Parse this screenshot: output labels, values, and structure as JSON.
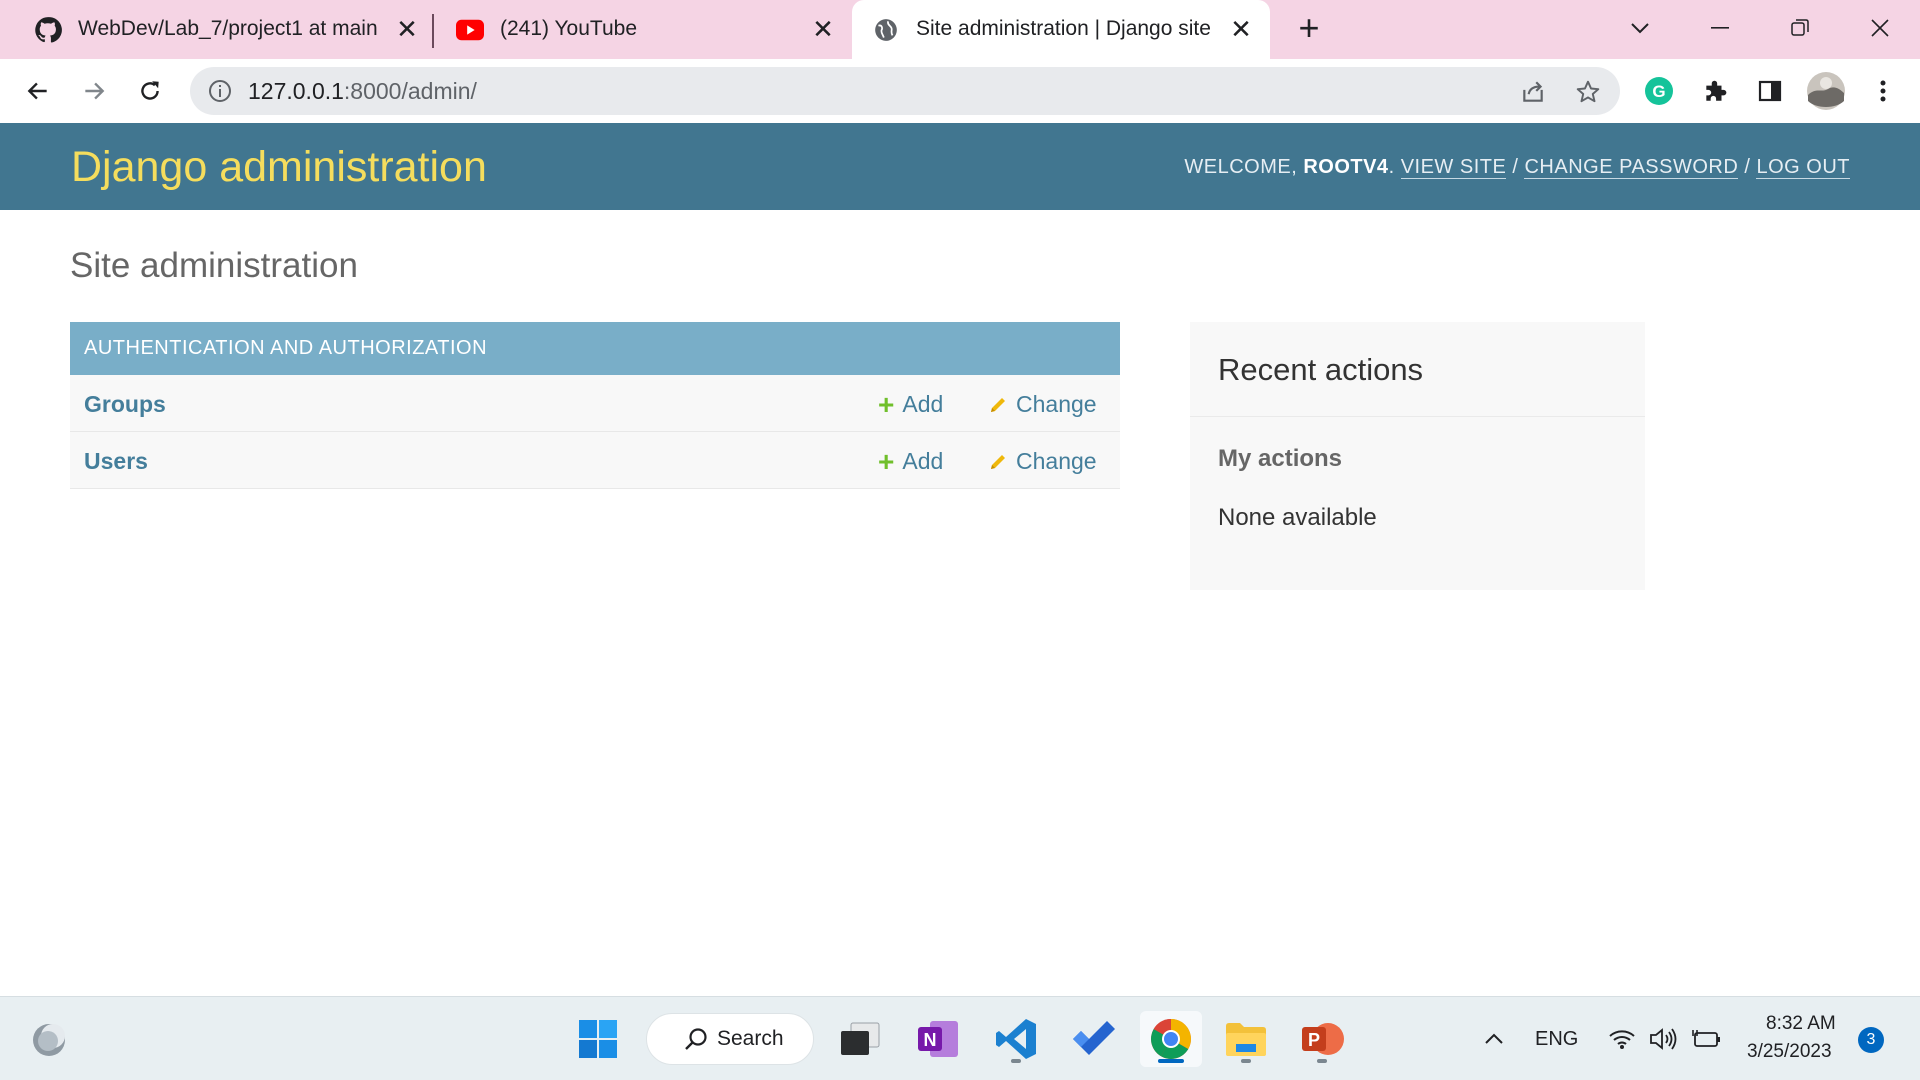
{
  "browser": {
    "tabs": [
      {
        "title": "WebDev/Lab_7/project1 at main",
        "icon": "github-icon",
        "active": false
      },
      {
        "title": "(241) YouTube",
        "icon": "youtube-icon",
        "active": false
      },
      {
        "title": "Site administration | Django site admin",
        "icon": "globe-icon",
        "active": true
      }
    ],
    "url_host": "127.0.0.1",
    "url_rest": ":8000/admin/"
  },
  "django": {
    "branding": "Django administration",
    "welcome": "WELCOME, ",
    "username": "ROOTV4",
    "period": ". ",
    "view_site": "VIEW SITE",
    "change_password": "CHANGE PASSWORD",
    "log_out": "LOG OUT",
    "sep": " / ",
    "page_title": "Site administration",
    "module": {
      "caption": "AUTHENTICATION AND AUTHORIZATION",
      "rows": [
        {
          "name": "Groups",
          "add": "Add",
          "change": "Change"
        },
        {
          "name": "Users",
          "add": "Add",
          "change": "Change"
        }
      ]
    },
    "recent": {
      "title": "Recent actions",
      "subtitle": "My actions",
      "empty": "None available"
    }
  },
  "taskbar": {
    "search_label": "Search",
    "language": "ENG",
    "time": "8:32 AM",
    "date": "3/25/2023",
    "notification_count": "3"
  },
  "colors": {
    "header_bg": "#417690",
    "brand": "#f5dd5d",
    "caption_bg": "#79aec8",
    "link": "#447e9b",
    "add_green": "#70bf2b",
    "tab_strip": "#f5d4e4"
  }
}
